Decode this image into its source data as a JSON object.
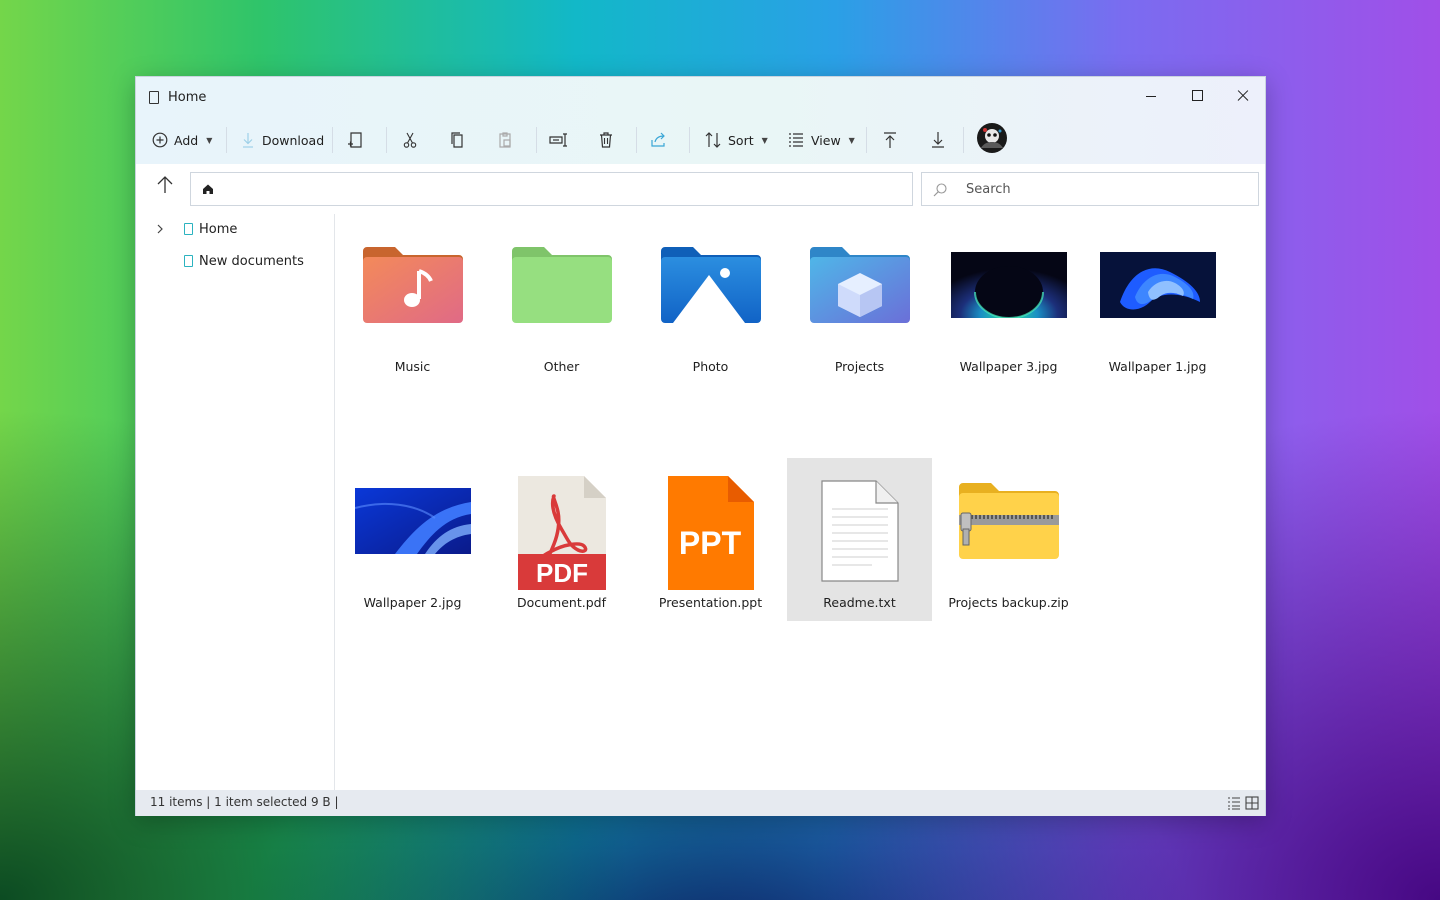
{
  "window": {
    "title": "Home"
  },
  "toolbar": {
    "add_label": "Add",
    "download_label": "Download",
    "sort_label": "Sort",
    "view_label": "View"
  },
  "search": {
    "placeholder": "Search"
  },
  "sidebar": {
    "items": [
      {
        "label": "Home",
        "icon": "document-icon",
        "expandable": true
      },
      {
        "label": "New documents",
        "icon": "document-icon",
        "expandable": false
      }
    ]
  },
  "files": [
    {
      "name": "Music",
      "kind": "music-folder-icon"
    },
    {
      "name": "Other",
      "kind": "green-folder-icon"
    },
    {
      "name": "Photo",
      "kind": "photo-folder-icon"
    },
    {
      "name": "Projects",
      "kind": "projects-folder-icon"
    },
    {
      "name": "Wallpaper 3.jpg",
      "kind": "image-thumbnail"
    },
    {
      "name": "Wallpaper 1.jpg",
      "kind": "image-thumbnail"
    },
    {
      "name": "Wallpaper 2.jpg",
      "kind": "image-thumbnail"
    },
    {
      "name": "Document.pdf",
      "kind": "pdf-file-icon",
      "badge": "PDF"
    },
    {
      "name": "Presentation.ppt",
      "kind": "ppt-file-icon",
      "badge": "PPT"
    },
    {
      "name": "Readme.txt",
      "kind": "text-file-icon",
      "selected": true
    },
    {
      "name": "Projects backup.zip",
      "kind": "zip-folder-icon"
    }
  ],
  "status": {
    "text": "11 items | 1 item selected 9 B |"
  },
  "colors": {
    "accent": "#2bb3c0",
    "selection": "#e4e4e4",
    "pdf_red": "#d93a3a",
    "ppt_orange": "#ff7a00"
  }
}
